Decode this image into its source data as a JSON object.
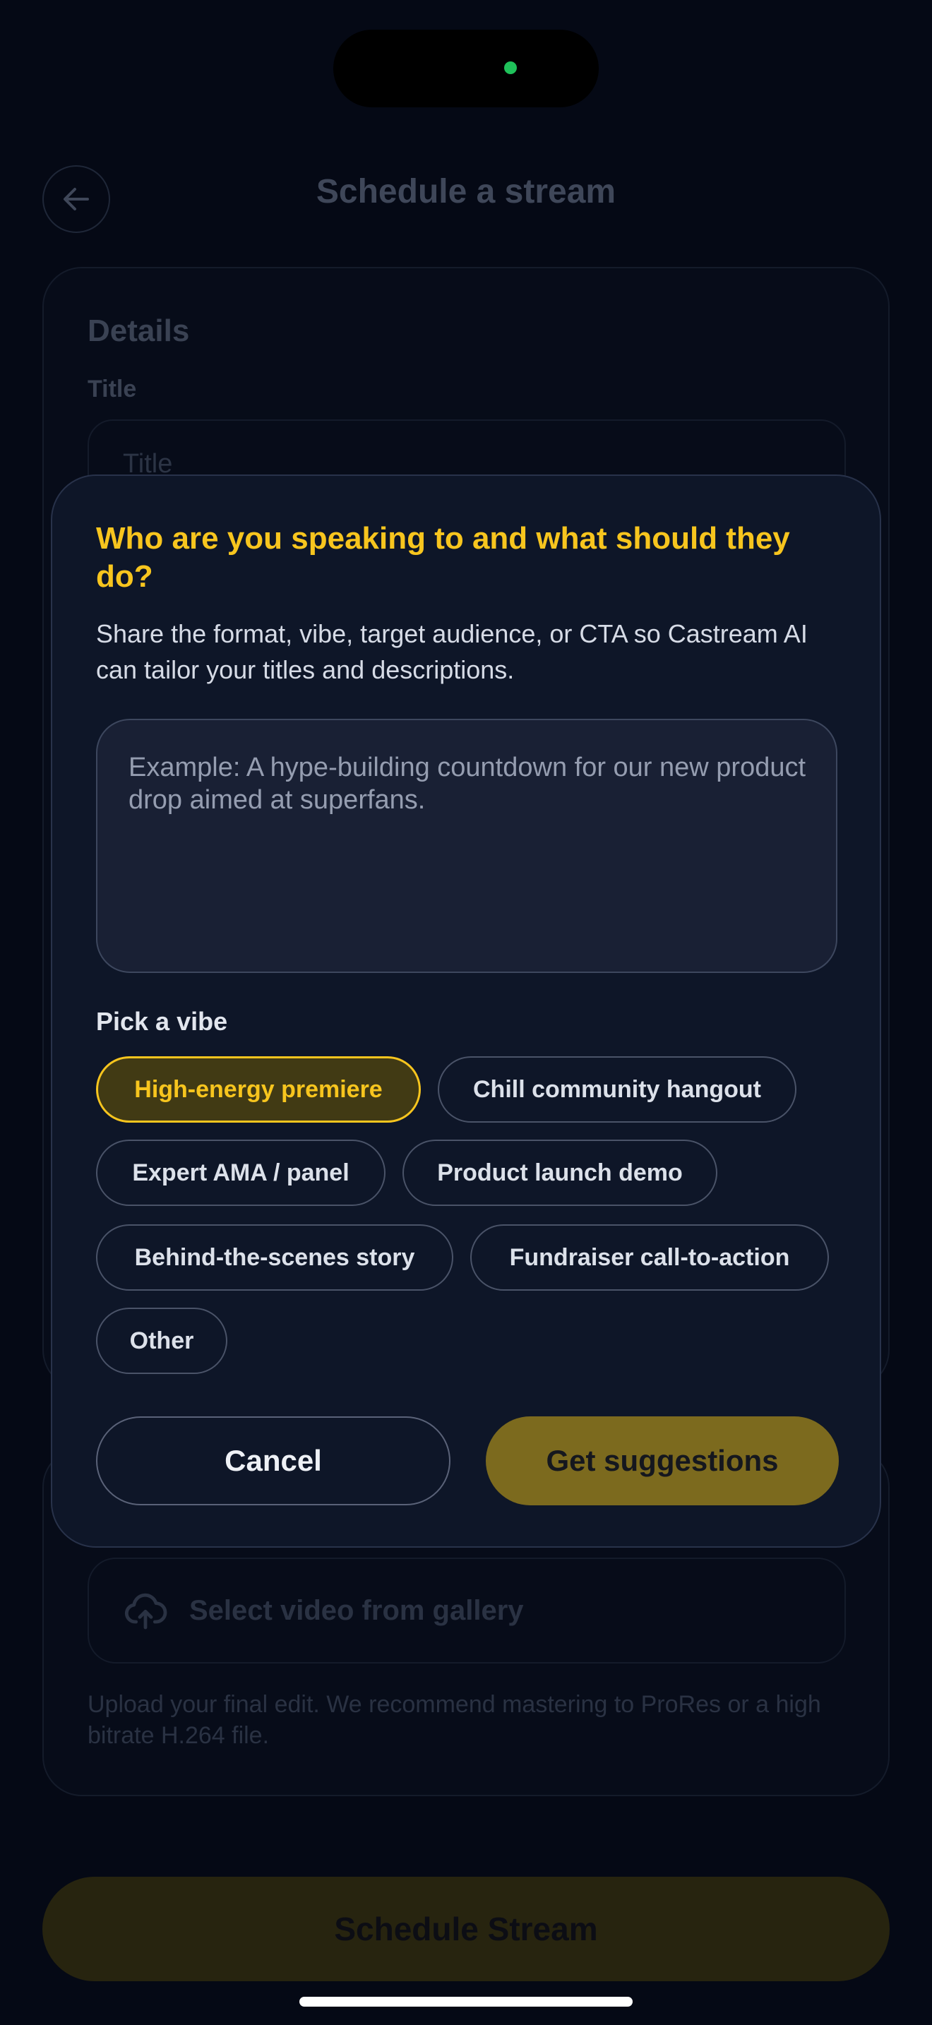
{
  "header": {
    "title": "Schedule a stream",
    "back_icon": "arrow-left-icon"
  },
  "details_card": {
    "section_title": "Details",
    "title_label": "Title",
    "title_placeholder": "Title"
  },
  "video_card": {
    "upload_icon": "cloud-upload-icon",
    "upload_label": "Select video from gallery",
    "help_text": "Upload your final edit. We recommend mastering to ProRes or a high bitrate H.264 file."
  },
  "schedule_button_label": "Schedule Stream",
  "modal": {
    "title": "Who are you speaking to and what should they do?",
    "description": "Share the format, vibe, target audience, or CTA so Castream AI can tailor your titles and descriptions.",
    "prompt_placeholder": "Example: A hype-building countdown for our new product drop aimed at superfans.",
    "prompt_value": "",
    "vibe_label": "Pick a vibe",
    "vibes": [
      {
        "label": "High-energy premiere",
        "selected": true
      },
      {
        "label": "Chill community hangout",
        "selected": false
      },
      {
        "label": "Expert AMA / panel",
        "selected": false
      },
      {
        "label": "Product launch demo",
        "selected": false
      },
      {
        "label": "Behind-the-scenes story",
        "selected": false
      },
      {
        "label": "Fundraiser call-to-action",
        "selected": false
      },
      {
        "label": "Other",
        "selected": false
      }
    ],
    "cancel_label": "Cancel",
    "submit_label": "Get suggestions"
  },
  "colors": {
    "accent": "#f7c51e",
    "background": "#050915",
    "modal_surface": "#0e1628",
    "status_dot": "#1fc15a"
  }
}
